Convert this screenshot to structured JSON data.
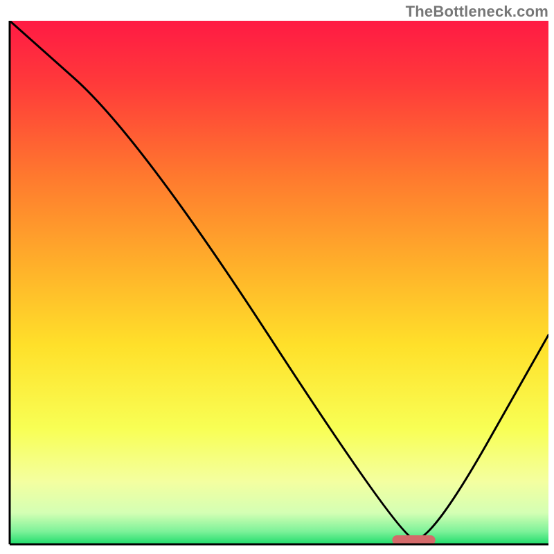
{
  "watermark": "TheBottleneck.com",
  "chart_data": {
    "type": "line",
    "xlim": [
      0,
      100
    ],
    "ylim": [
      0,
      100
    ],
    "title": "",
    "xlabel": "",
    "ylabel": "",
    "x": [
      0,
      24,
      72,
      78,
      100
    ],
    "values": [
      100,
      78,
      2,
      0,
      40
    ],
    "marker": {
      "x_start": 71,
      "x_end": 79,
      "y": 0.8
    },
    "gradient_stops": [
      {
        "offset": 0.0,
        "color": "#ff1a44"
      },
      {
        "offset": 0.12,
        "color": "#ff3a3a"
      },
      {
        "offset": 0.3,
        "color": "#ff7a2e"
      },
      {
        "offset": 0.48,
        "color": "#ffb42a"
      },
      {
        "offset": 0.62,
        "color": "#ffe02a"
      },
      {
        "offset": 0.78,
        "color": "#f8ff55"
      },
      {
        "offset": 0.88,
        "color": "#f4ffa0"
      },
      {
        "offset": 0.94,
        "color": "#d4ffb4"
      },
      {
        "offset": 0.975,
        "color": "#7ef29a"
      },
      {
        "offset": 1.0,
        "color": "#1fdc6b"
      }
    ],
    "axis_color": "#000000",
    "curve_color": "#000000",
    "marker_color": "#d46a6a",
    "background_outside": "#ffffff"
  }
}
